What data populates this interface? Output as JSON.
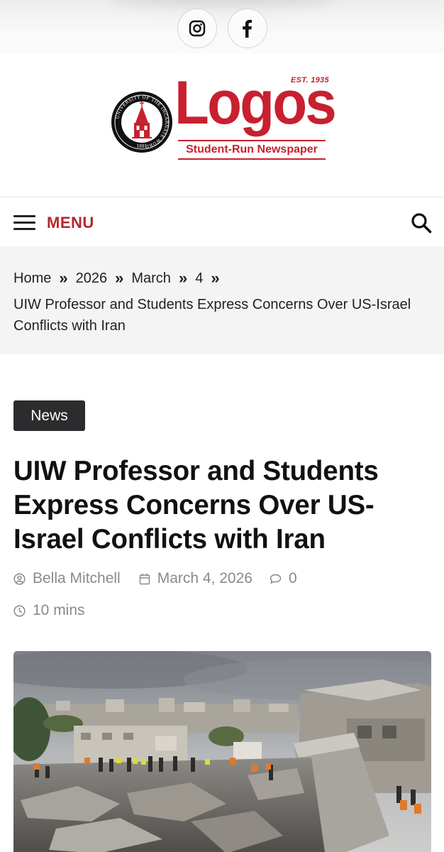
{
  "social": {
    "instagram_icon": "instagram-icon",
    "facebook_icon": "facebook-icon"
  },
  "masthead": {
    "seal_text": "UNIVERSITY OF THE INCARNATE WORD",
    "seal_year": "1881",
    "logo_word": "Logos",
    "est": "EST. 1935",
    "tagline": "Student-Run Newspaper",
    "brand_color": "#c8202f"
  },
  "menubar": {
    "menu_label": "MENU",
    "menu_icon": "hamburger-icon",
    "search_icon": "search-icon"
  },
  "breadcrumb": {
    "items": [
      "Home",
      "2026",
      "March",
      "4"
    ],
    "separator": "»",
    "current": "UIW Professor and Students Express Concerns Over US-Israel Conflicts with Iran"
  },
  "article": {
    "category": "News",
    "title": "UIW Professor and Students Express Concerns Over US-Israel Conflicts with Iran",
    "author": "Bella Mitchell",
    "date": "March 4, 2026",
    "comments": "0",
    "read_time": "10 mins"
  }
}
